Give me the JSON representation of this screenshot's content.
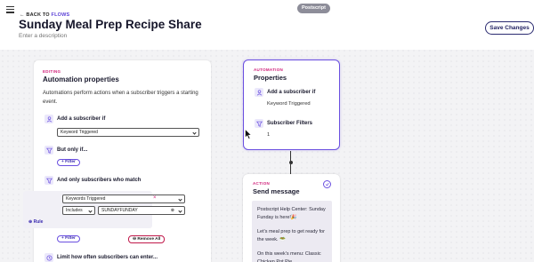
{
  "header": {
    "brand": "Postscript",
    "back_prefix": "← BACK TO",
    "back_target": "FLOWS",
    "title": "Sunday Meal Prep Recipe Share",
    "description_placeholder": "Enter a description",
    "save_label": "Save Changes"
  },
  "editor": {
    "tag": "EDITING",
    "title": "Automation properties",
    "description": "Automations perform actions when a subscriber triggers a starting event.",
    "trigger_label": "Add a subscriber if",
    "trigger_value": "Keyword Triggered",
    "condition_label": "But only if...",
    "filter_button": "+ Filter",
    "match_label": "And only subscribers who match",
    "rule": {
      "field": "Keywords Triggered",
      "operator": "Includes",
      "value": "SUNDAYFUNDAY",
      "remove_glyph": "×",
      "add_rule": "⊕ Rule"
    },
    "filter_button_2": "+ Filter",
    "remove_all": "⊖ Remove All",
    "limit_label": "Limit how often subscribers can enter..."
  },
  "properties_card": {
    "tag": "AUTOMATION",
    "title": "Properties",
    "trigger_label": "Add a subscriber if",
    "trigger_value": "Keyword Triggered",
    "filters_label": "Subscriber Filters",
    "filters_count": "1"
  },
  "action_card": {
    "tag": "ACTION",
    "title": "Send message",
    "message_lines": [
      "Postscript Help Center: Sunday Funday is here!🎉",
      "Let's meal prep to get ready for the week. 🥗",
      "On this week's menu: Classic Chicken Pot Pie"
    ]
  },
  "colors": {
    "accent": "#6a4fe0",
    "tag_pink": "#d0207a",
    "navy": "#2a2a70"
  }
}
